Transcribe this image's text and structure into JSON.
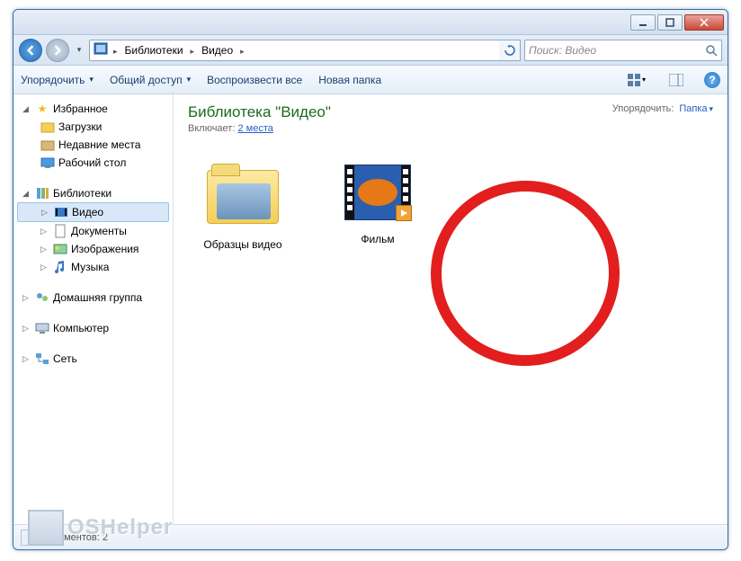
{
  "titlebar": {},
  "address": {
    "root": "Библиотеки",
    "current": "Видео"
  },
  "search": {
    "placeholder": "Поиск: Видео"
  },
  "toolbar": {
    "organize": "Упорядочить",
    "share": "Общий доступ",
    "playall": "Воспроизвести все",
    "newfolder": "Новая папка"
  },
  "sidebar": {
    "favorites": "Избранное",
    "fav_items": [
      "Загрузки",
      "Недавние места",
      "Рабочий стол"
    ],
    "libraries": "Библиотеки",
    "lib_items": [
      "Видео",
      "Документы",
      "Изображения",
      "Музыка"
    ],
    "homegroup": "Домашняя группа",
    "computer": "Компьютер",
    "network": "Сеть"
  },
  "content": {
    "title": "Библиотека \"Видео\"",
    "subtitle_prefix": "Включает:",
    "subtitle_link": "2 места",
    "sort_label": "Упорядочить:",
    "sort_value": "Папка",
    "items": [
      {
        "name": "Образцы видео",
        "type": "folder"
      },
      {
        "name": "Фильм",
        "type": "video"
      }
    ]
  },
  "statusbar": {
    "count_label": "Элементов: 2"
  },
  "watermark": "OSHelper"
}
